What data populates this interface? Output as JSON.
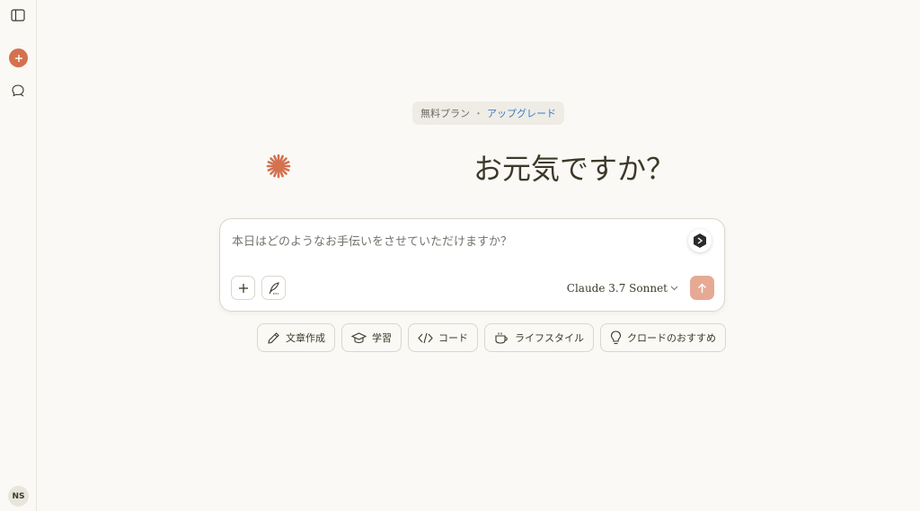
{
  "sidebar": {
    "user_initials": "NS"
  },
  "banner": {
    "plan": "無料プラン",
    "separator": "・",
    "upgrade": "アップグレード"
  },
  "greeting": "お元気ですか？",
  "composer": {
    "placeholder": "本日はどのようなお手伝いをさせていただけますか？",
    "model": "Claude 3.7 Sonnet"
  },
  "chips": [
    {
      "label": "文章作成",
      "icon": "pencil-icon"
    },
    {
      "label": "学習",
      "icon": "graduation-cap-icon"
    },
    {
      "label": "コード",
      "icon": "code-icon"
    },
    {
      "label": "ライフスタイル",
      "icon": "coffee-cup-icon"
    },
    {
      "label": "クロードのおすすめ",
      "icon": "lightbulb-icon"
    }
  ],
  "colors": {
    "background": "#faf9f5",
    "accent": "#d4714f",
    "send_button": "#e6a994",
    "upgrade_link": "#3d7bc4"
  }
}
